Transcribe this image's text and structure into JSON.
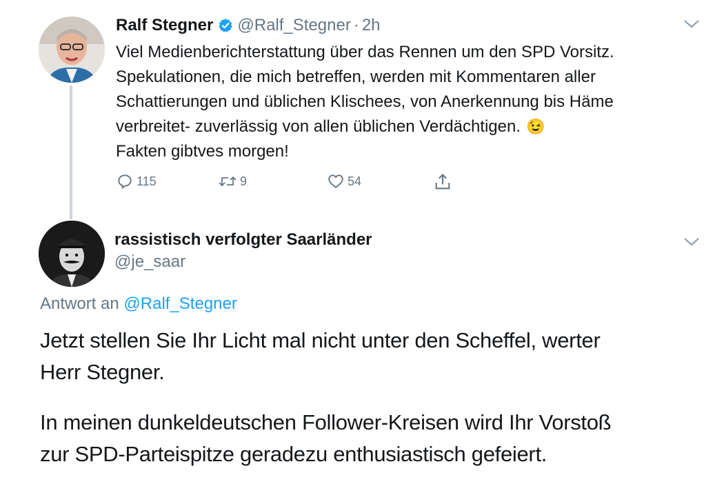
{
  "tweet1": {
    "author_name": "Ralf Stegner",
    "verified_icon": "verified-badge-icon",
    "handle": "@Ralf_Stegner",
    "separator": "·",
    "time": "2h",
    "lines": [
      "Viel Medienberichterstattung über das Rennen um den SPD Vorsitz.",
      "Spekulationen, die mich betreffen, werden mit Kommentaren aller",
      "Schattierungen und üblichen Klischees, von Anerkennung bis Häme",
      "verbreitet- zuverlässig von allen üblichen Verdächtigen.",
      "Fakten gibtves morgen!"
    ],
    "emoji": "😉",
    "actions": {
      "reply_count": "115",
      "retweet_count": "9",
      "like_count": "54"
    }
  },
  "tweet2": {
    "author_name": "rassistisch verfolgter Saarländer",
    "handle": "@je_saar",
    "reply_prefix": "Antwort an",
    "reply_to": "@Ralf_Stegner",
    "paragraph1_lines": [
      "Jetzt stellen Sie Ihr Licht mal nicht unter den Scheffel, werter",
      "Herr Stegner."
    ],
    "paragraph2_lines": [
      "In meinen dunkeldeutschen Follower-Kreisen wird Ihr Vorstoß",
      "zur SPD-Parteispitze geradezu enthusiastisch gefeiert."
    ]
  },
  "colors": {
    "link_blue": "#1da1f2",
    "muted": "#657786",
    "thread_line": "#ccd6dd"
  }
}
